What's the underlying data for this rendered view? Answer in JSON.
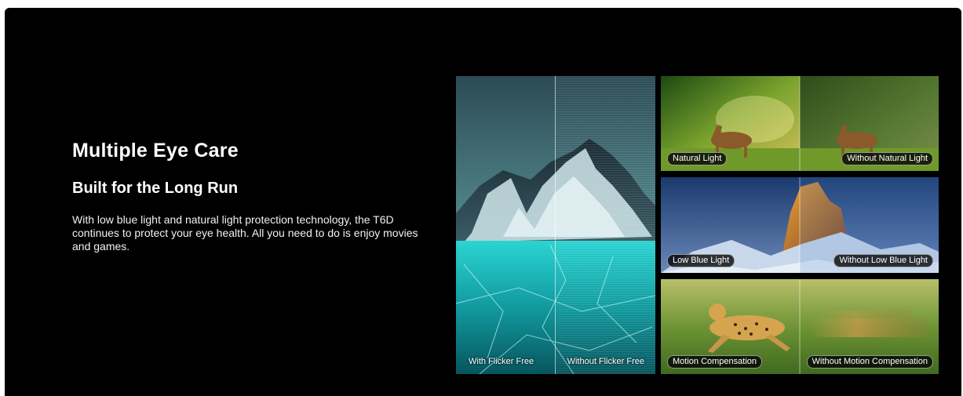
{
  "heading": {
    "title": "Multiple Eye Care",
    "subtitle": "Built for the Long Run",
    "description": "With low blue light and natural light protection technology, the T6D continues to protect your eye health. All you need to do is enjoy movies and games."
  },
  "comparisons": {
    "flicker": {
      "left_label": "With Flicker Free",
      "right_label": "Without Flicker Free"
    },
    "natural_light": {
      "left_label": "Natural Light",
      "right_label": "Without Natural Light"
    },
    "blue_light": {
      "left_label": "Low Blue Light",
      "right_label": "Without Low Blue Light"
    },
    "motion": {
      "left_label": "Motion  Compensation",
      "right_label": "Without Motion Compensation"
    }
  },
  "colors": {
    "panel_background": "#000000",
    "text": "#ffffff"
  }
}
